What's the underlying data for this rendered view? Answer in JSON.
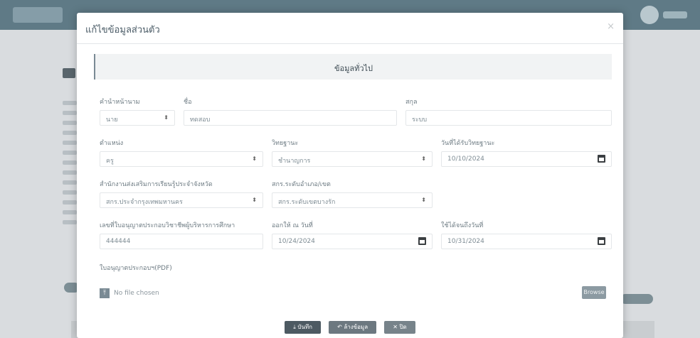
{
  "modal": {
    "title": "แก้ไขข้อมูลส่วนตัว",
    "close_icon": "close-icon",
    "section_title": "ข้อมูลทั่วไป"
  },
  "form": {
    "prefix": {
      "label": "คำนำหน้านาม",
      "value": "นาย"
    },
    "first_name": {
      "label": "ชื่อ",
      "value": "ทดสอบ"
    },
    "last_name": {
      "label": "สกุล",
      "value": "ระบบ"
    },
    "position": {
      "label": "ตำแหน่ง",
      "value": "ครู"
    },
    "academic_standing": {
      "label": "วิทยฐานะ",
      "value": "ชำนาญการ"
    },
    "academic_date": {
      "label": "วันที่ได้รับวิทยฐานะ",
      "value": "10/10/2024"
    },
    "office": {
      "label": "สำนักงานส่งเสริมการเรียนรู้ประจำจังหวัด",
      "value": "สกร.ประจำกรุงเทพมหานคร"
    },
    "district": {
      "label": "สกร.ระดับอำเภอ/เขต",
      "value": "สกร.ระดับเขตบางรัก"
    },
    "license_number": {
      "label": "เลขที่ใบอนุญาตประกอบวิชาชีพผู้บริหารการศึกษา",
      "value": "444444"
    },
    "issue_date": {
      "label": "ออกให้ ณ วันที่",
      "value": "10/24/2024"
    },
    "expiry_date": {
      "label": "ใช้ได้จนถึงวันที่",
      "value": "10/31/2024"
    },
    "license_file": {
      "label": "ใบอนุญาตประกอบฯ(PDF)",
      "status": "No file chosen",
      "browse": "Browse"
    }
  },
  "buttons": {
    "save": "บันทึก",
    "reset": "ล้างข้อมูล",
    "close": "ปิด"
  },
  "colors": {
    "modal_bg": "#ffffff",
    "overlay": "#d9dcdf",
    "save_button": "#4d5a62"
  }
}
